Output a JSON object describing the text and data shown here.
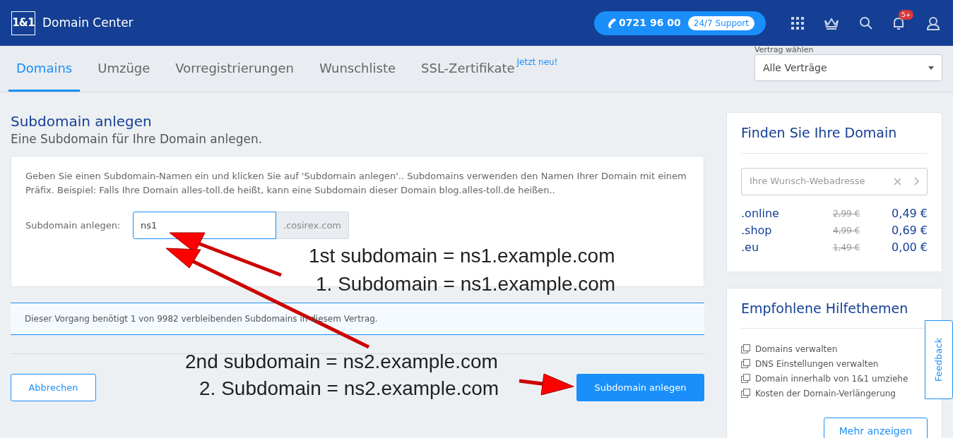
{
  "header": {
    "logo": "1&1",
    "title": "Domain Center",
    "phone": "0721 96 00",
    "support": "24/7 Support",
    "notifications_badge": "5+"
  },
  "tabs": [
    {
      "label": "Domains",
      "selected": true
    },
    {
      "label": "Umzüge",
      "selected": false
    },
    {
      "label": "Vorregistrierungen",
      "selected": false
    },
    {
      "label": "Wunschliste",
      "selected": false
    },
    {
      "label": "SSL-Zertifikate",
      "selected": false,
      "badge": "Jetzt neu!"
    }
  ],
  "contract": {
    "label": "Vertrag wählen",
    "value": "Alle Verträge"
  },
  "page": {
    "title": "Subdomain anlegen",
    "subtitle": "Eine Subdomain für Ihre Domain anlegen."
  },
  "form": {
    "description": "Geben Sie einen Subdomain-Namen ein und klicken Sie auf 'Subdomain anlegen'.. Subdomains verwenden den Namen Ihrer Domain mit einem Präfix. Beispiel: Falls Ihre Domain alles-toll.de heißt, kann eine Subdomain dieser Domain blog.alles-toll.de heißen..",
    "field_label": "Subdomain anlegen:",
    "value": "ns1",
    "suffix": ".cosirex.com"
  },
  "info": "Dieser Vorgang benötigt 1 von 9982 verbleibenden Subdomains in diesem Vertrag.",
  "buttons": {
    "cancel": "Abbrechen",
    "submit": "Subdomain anlegen"
  },
  "domain_search": {
    "title": "Finden Sie Ihre Domain",
    "placeholder": "Ihre Wunsch-Webadresse",
    "prices": [
      {
        "tld": ".online",
        "old": "2,99 €",
        "new": "0,49 €"
      },
      {
        "tld": ".shop",
        "old": "4,99 €",
        "new": "0,69 €"
      },
      {
        "tld": ".eu",
        "old": "1,49 €",
        "new": "0,00 €"
      }
    ]
  },
  "help": {
    "title": "Empfohlene Hilfethemen",
    "items": [
      "Domains verwalten",
      "DNS Einstellungen verwalten",
      "Domain innerhalb von 1&1 umziehe",
      "Kosten der Domain-Verlängerung"
    ],
    "more": "Mehr anzeigen"
  },
  "feedback": "Feedback",
  "annotations": [
    "1st subdomain = ns1.example.com",
    "1. Subdomain = ns1.example.com",
    "2nd subdomain = ns2.example.com",
    "2. Subdomain = ns2.example.com"
  ]
}
